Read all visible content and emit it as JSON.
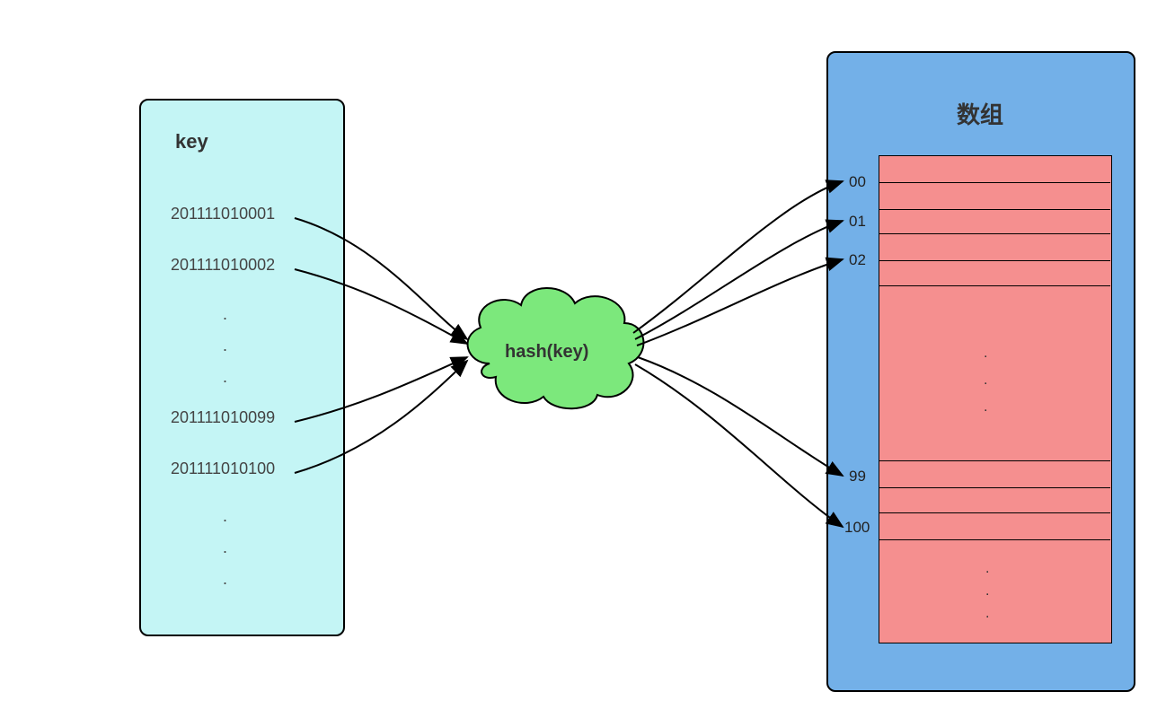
{
  "keyBox": {
    "title": "key",
    "items": [
      "201111010001",
      "201111010002",
      "201111010099",
      "201111010100"
    ]
  },
  "hash": {
    "label": "hash(key)"
  },
  "arrayBox": {
    "title": "数组",
    "indices": [
      "00",
      "01",
      "02",
      "99",
      "100"
    ]
  }
}
